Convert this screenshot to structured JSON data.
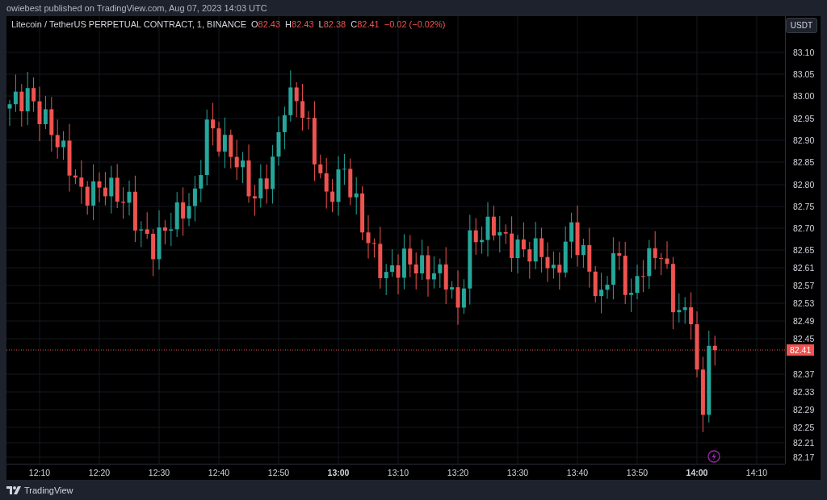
{
  "header": {
    "text": "owiebest published on TradingView.com, Aug 07, 2023 14:03 UTC"
  },
  "legend": {
    "symbol": "Litecoin / TetherUS PERPETUAL CONTRACT, 1, BINANCE",
    "ohlc": [
      {
        "label": "O",
        "value": "82.43"
      },
      {
        "label": "H",
        "value": "82.43"
      },
      {
        "label": "L",
        "value": "82.38"
      },
      {
        "label": "C",
        "value": "82.41"
      }
    ],
    "change": "−0.02 (−0.02%)"
  },
  "currency_button": "USDT",
  "price_axis": [
    "83.10",
    "83.05",
    "83.00",
    "82.95",
    "82.90",
    "82.85",
    "82.80",
    "82.75",
    "82.70",
    "82.65",
    "82.61",
    "82.57",
    "82.53",
    "82.49",
    "82.45",
    "82.37",
    "82.33",
    "82.29",
    "82.25",
    "82.21",
    "82.17"
  ],
  "last_price": "82.41",
  "time_axis": [
    {
      "label": "12:10",
      "bold": false
    },
    {
      "label": "12:20",
      "bold": false
    },
    {
      "label": "12:30",
      "bold": false
    },
    {
      "label": "12:40",
      "bold": false
    },
    {
      "label": "12:50",
      "bold": false
    },
    {
      "label": "13:00",
      "bold": true
    },
    {
      "label": "13:10",
      "bold": false
    },
    {
      "label": "13:20",
      "bold": false
    },
    {
      "label": "13:30",
      "bold": false
    },
    {
      "label": "13:40",
      "bold": false
    },
    {
      "label": "13:50",
      "bold": false
    },
    {
      "label": "14:00",
      "bold": true
    },
    {
      "label": "14:10",
      "bold": false
    }
  ],
  "footer": {
    "brand": "TradingView"
  }
}
